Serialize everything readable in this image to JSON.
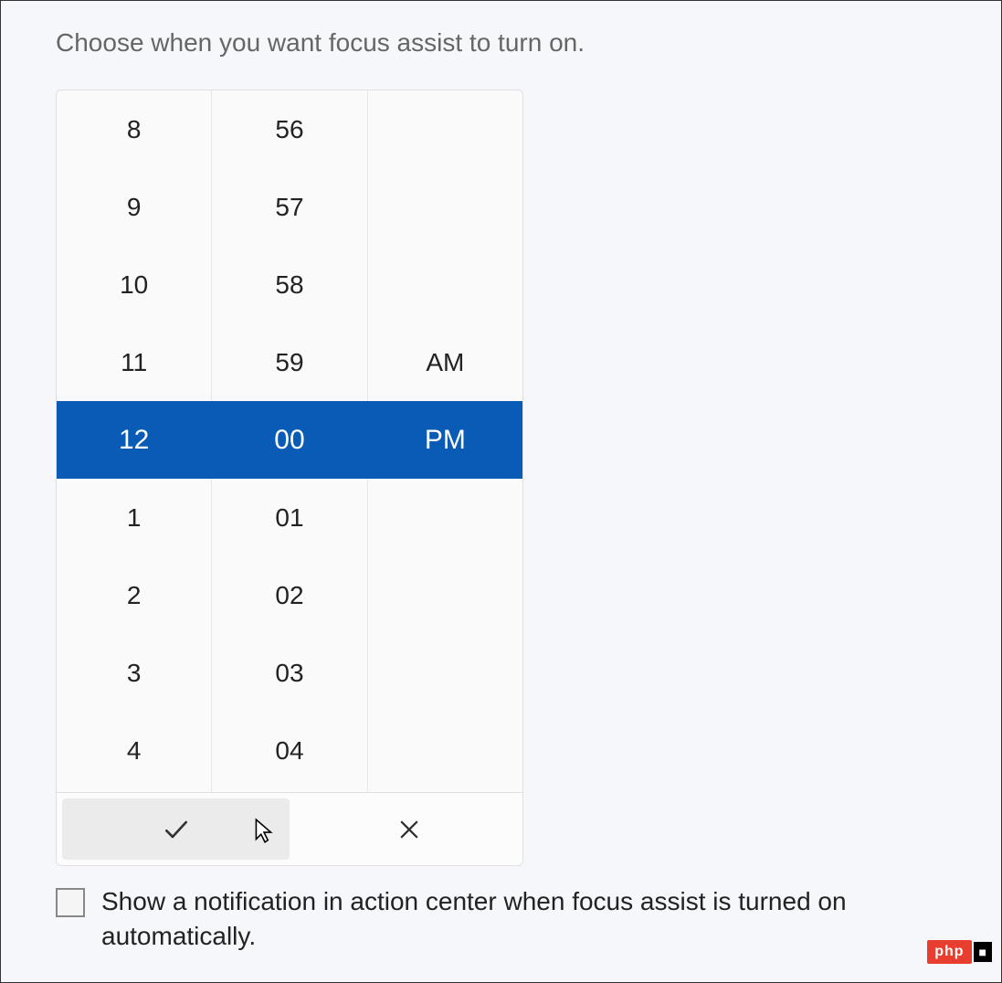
{
  "heading": "Choose when you want focus assist to turn on.",
  "picker": {
    "hours": [
      "8",
      "9",
      "10",
      "11",
      "12",
      "1",
      "2",
      "3",
      "4"
    ],
    "minutes": [
      "56",
      "57",
      "58",
      "59",
      "00",
      "01",
      "02",
      "03",
      "04"
    ],
    "period_above": "AM",
    "period_selected": "PM",
    "selected_index": 4
  },
  "checkbox": {
    "label": "Show a notification in action center when focus assist is turned on automatically.",
    "checked": false
  },
  "watermark": {
    "badge": "php",
    "tail": "■"
  }
}
